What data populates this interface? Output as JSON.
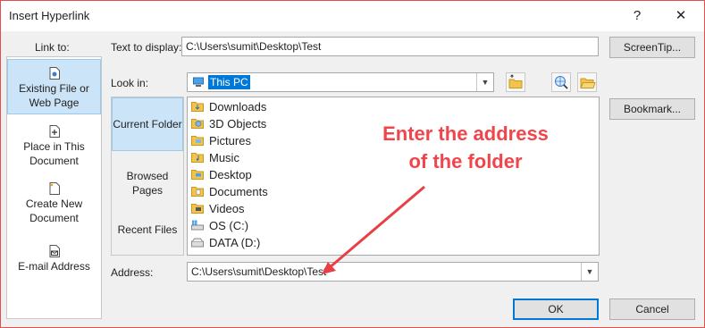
{
  "window": {
    "title": "Insert Hyperlink",
    "help_glyph": "?",
    "close_glyph": "✕"
  },
  "link_to": {
    "label": "Link to:",
    "items": [
      {
        "label": "Existing File or Web Page",
        "line1": "Existing File or",
        "line2": "Web Page",
        "icon": "existing-file-icon",
        "selected": true
      },
      {
        "label": "Place in This Document",
        "line1": "Place in This",
        "line2": "Document",
        "icon": "place-in-document-icon",
        "selected": false
      },
      {
        "label": "Create New Document",
        "line1": "Create New",
        "line2": "Document",
        "icon": "create-new-document-icon",
        "selected": false
      },
      {
        "label": "E-mail Address",
        "line1": "E-mail Address",
        "line2": "",
        "icon": "email-address-icon",
        "selected": false
      }
    ]
  },
  "text_to_display": {
    "label": "Text to display:",
    "value": "C:\\Users\\sumit\\Desktop\\Test"
  },
  "look_in": {
    "label": "Look in:",
    "value": "This PC"
  },
  "middle_nav": [
    {
      "label": "Current Folder",
      "selected": true
    },
    {
      "label": "Browsed Pages",
      "selected": false
    },
    {
      "label": "Recent Files",
      "selected": false
    }
  ],
  "files": [
    {
      "name": "Downloads",
      "icon": "downloads-folder-icon"
    },
    {
      "name": "3D Objects",
      "icon": "3d-objects-folder-icon"
    },
    {
      "name": "Pictures",
      "icon": "pictures-folder-icon"
    },
    {
      "name": "Music",
      "icon": "music-folder-icon"
    },
    {
      "name": "Desktop",
      "icon": "desktop-folder-icon"
    },
    {
      "name": "Documents",
      "icon": "documents-folder-icon"
    },
    {
      "name": "Videos",
      "icon": "videos-folder-icon"
    },
    {
      "name": "OS (C:)",
      "icon": "windows-drive-icon"
    },
    {
      "name": "DATA (D:)",
      "icon": "drive-icon"
    }
  ],
  "address": {
    "label": "Address:",
    "value": "C:\\Users\\sumit\\Desktop\\Test"
  },
  "buttons": {
    "screentip": "ScreenTip...",
    "bookmark": "Bookmark...",
    "ok": "OK",
    "cancel": "Cancel"
  },
  "annotation": {
    "line1": "Enter the address",
    "line2": "of the folder"
  },
  "colors": {
    "annotation": "#f0454b",
    "selection": "#cce4f7",
    "accent": "#0078d7"
  }
}
